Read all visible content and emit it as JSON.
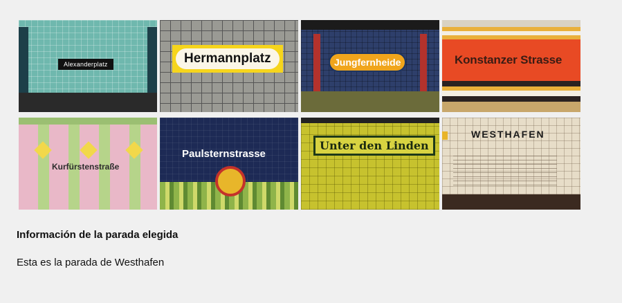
{
  "gallery": {
    "items": [
      {
        "label": "Alexanderplatz"
      },
      {
        "label": "Hermannplatz"
      },
      {
        "label": "Jungfernheide"
      },
      {
        "label": "Konstanzer Strasse"
      },
      {
        "label": "Kurfürstenstraße"
      },
      {
        "label": "Paulsternstrasse"
      },
      {
        "label": "Unter den Linden"
      },
      {
        "label": "WESTHAFEN"
      }
    ]
  },
  "info": {
    "title": "Información de la parada elegida",
    "text": "Esta es la parada de Westhafen"
  }
}
